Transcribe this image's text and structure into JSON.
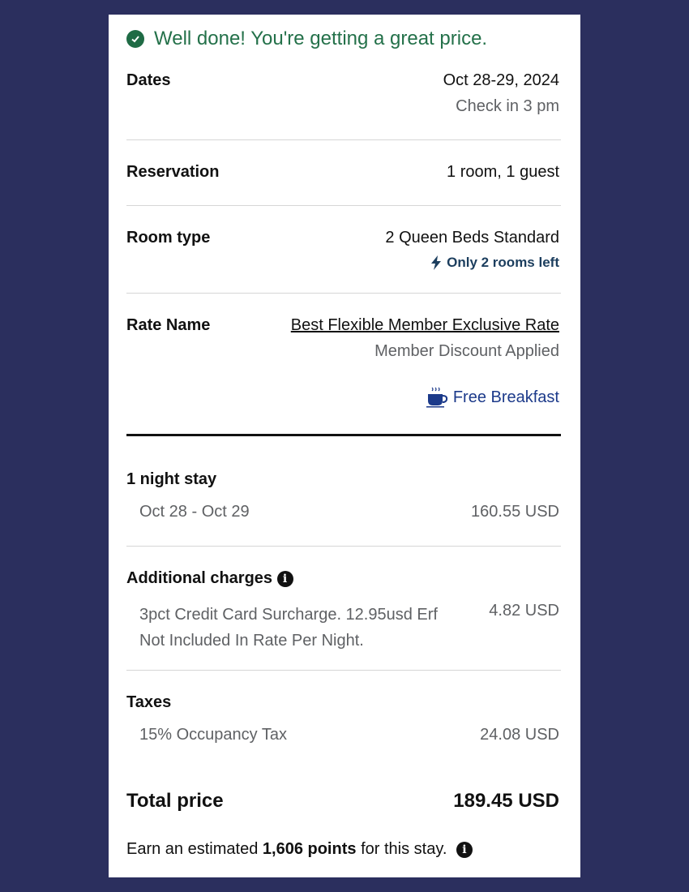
{
  "banner": {
    "icon": "check-circle-icon",
    "text": "Well done! You're getting a great price.",
    "color": "#24714a"
  },
  "dates": {
    "label": "Dates",
    "value": "Oct 28-29, 2024",
    "sub": "Check in 3 pm"
  },
  "reservation": {
    "label": "Reservation",
    "value": "1 room, 1 guest"
  },
  "room_type": {
    "label": "Room type",
    "value": "2 Queen Beds Standard",
    "scarcity_icon": "lightning-icon",
    "scarcity": "Only 2 rooms left"
  },
  "rate": {
    "label": "Rate Name",
    "value": "Best Flexible Member Exclusive Rate",
    "sub": "Member Discount Applied",
    "perk_icon": "coffee-cup-icon",
    "perk": "Free Breakfast"
  },
  "stay": {
    "label": "1 night stay",
    "dates": "Oct 28 - Oct 29",
    "amount": "160.55 USD"
  },
  "additional": {
    "label": "Additional charges",
    "info_icon": "info-icon",
    "desc_line1": "3pct Credit Card Surcharge. 12.95usd Erf",
    "desc_line2": "Not Included In Rate Per Night.",
    "amount": "4.82 USD"
  },
  "taxes": {
    "label": "Taxes",
    "desc": "15% Occupancy Tax",
    "amount": "24.08 USD"
  },
  "total": {
    "label": "Total price",
    "amount": "189.45 USD"
  },
  "earn": {
    "prefix": "Earn an estimated",
    "points": "1,606 points",
    "suffix": "for this stay.",
    "info_icon": "info-icon"
  }
}
